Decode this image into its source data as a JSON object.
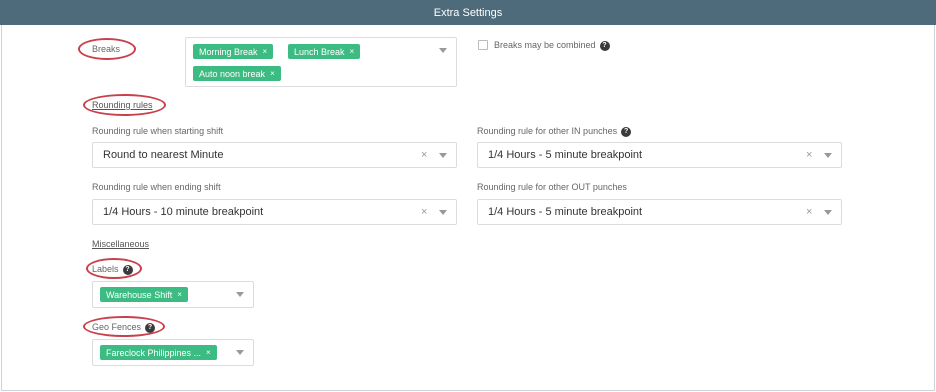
{
  "header": {
    "title": "Extra Settings"
  },
  "breaks": {
    "label": "Breaks",
    "tags": [
      "Morning Break",
      "Lunch Break",
      "Auto noon break"
    ],
    "combine_label": "Breaks may be combined",
    "combine_checked": false
  },
  "rounding": {
    "section_label": "Rounding rules",
    "start_label": "Rounding rule when starting shift",
    "start_value": "Round to nearest Minute",
    "end_label": "Rounding rule when ending shift",
    "end_value": "1/4 Hours - 10 minute breakpoint",
    "other_in_label": "Rounding rule for other IN punches",
    "other_in_value": "1/4 Hours - 5 minute breakpoint",
    "other_out_label": "Rounding rule for other OUT punches",
    "other_out_value": "1/4 Hours - 5 minute breakpoint"
  },
  "misc": {
    "section_label": "Miscellaneous",
    "labels_label": "Labels",
    "labels_tags": [
      "Warehouse Shift"
    ],
    "geofences_label": "Geo Fences",
    "geofences_tags": [
      "Fareclock Philippines ..."
    ]
  },
  "glyphs": {
    "clear": "×",
    "tag_remove": "×",
    "help": "?"
  },
  "colors": {
    "header_bg": "#4e6b7b",
    "tag_bg": "#3cbc82",
    "annotation": "#c9404b"
  }
}
